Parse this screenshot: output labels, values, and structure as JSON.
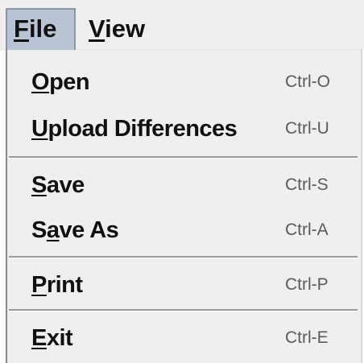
{
  "menubar": {
    "items": [
      {
        "label": "File",
        "mnemonic": "F",
        "rest": "ile",
        "state": "selected"
      },
      {
        "label": "View",
        "mnemonic": "V",
        "rest": "iew"
      }
    ]
  },
  "file_menu": {
    "items": [
      {
        "label": "Open",
        "pre": "",
        "mnemonic": "O",
        "post": "pen",
        "shortcut": "Ctrl-O"
      },
      {
        "label": "Upload Differences",
        "pre": "",
        "mnemonic": "U",
        "post": "pload Differences",
        "shortcut": "Ctrl-U"
      },
      {
        "label": "Save",
        "pre": "",
        "mnemonic": "S",
        "post": "ave",
        "shortcut": "Ctrl-S"
      },
      {
        "label": "Save As",
        "pre": "S",
        "mnemonic": "a",
        "post": "ve As",
        "shortcut": "Ctrl-A"
      },
      {
        "label": "Print",
        "pre": "",
        "mnemonic": "P",
        "post": "rint",
        "shortcut": "Ctrl-P"
      },
      {
        "label": "Exit",
        "pre": "",
        "mnemonic": "E",
        "post": "xit",
        "shortcut": "Ctrl-E"
      }
    ]
  },
  "colors": {
    "menu_background": "#efefef",
    "selected_menu_highlight": "#b8c4d4",
    "shortcut_text": "#5a5a5a"
  }
}
